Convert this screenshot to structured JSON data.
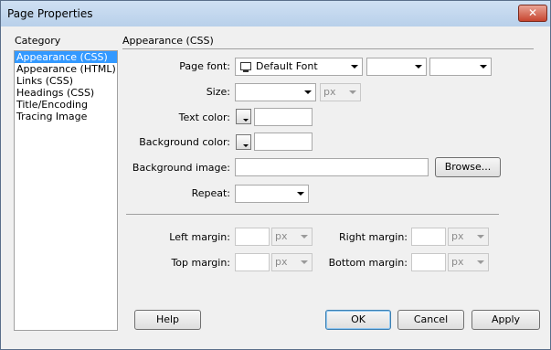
{
  "window": {
    "title": "Page Properties",
    "close_symbol": "✕"
  },
  "category": {
    "heading": "Category",
    "items": [
      "Appearance (CSS)",
      "Appearance (HTML)",
      "Links (CSS)",
      "Headings (CSS)",
      "Title/Encoding",
      "Tracing Image"
    ],
    "selected_index": 0
  },
  "section": {
    "title": "Appearance (CSS)"
  },
  "page_font": {
    "label": "Page font:",
    "value": "Default Font",
    "style_value": "",
    "weight_value": ""
  },
  "size": {
    "label": "Size:",
    "value": "",
    "unit": "px"
  },
  "text_color": {
    "label": "Text color:",
    "value": ""
  },
  "background_color": {
    "label": "Background color:",
    "value": ""
  },
  "background_image": {
    "label": "Background image:",
    "value": "",
    "browse_label": "Browse..."
  },
  "repeat": {
    "label": "Repeat:",
    "value": ""
  },
  "margins": {
    "left": {
      "label": "Left margin:",
      "value": "",
      "unit": "px"
    },
    "right": {
      "label": "Right margin:",
      "value": "",
      "unit": "px"
    },
    "top": {
      "label": "Top margin:",
      "value": "",
      "unit": "px"
    },
    "bottom": {
      "label": "Bottom margin:",
      "value": "",
      "unit": "px"
    }
  },
  "buttons": {
    "help": "Help",
    "ok": "OK",
    "cancel": "Cancel",
    "apply": "Apply"
  }
}
